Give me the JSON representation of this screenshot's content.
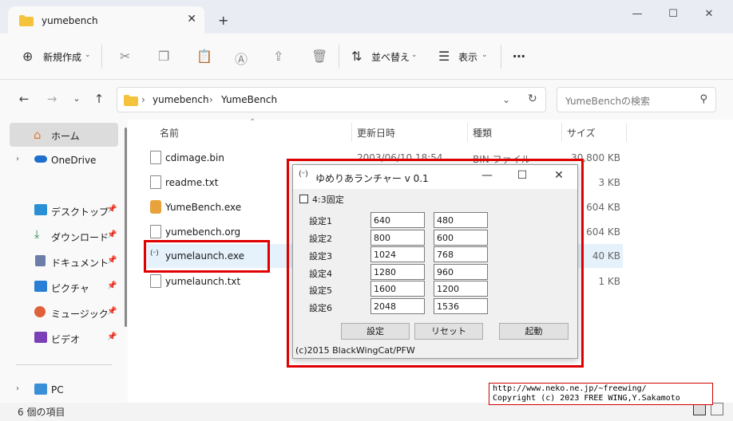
{
  "window": {
    "tab_title": "yumebench",
    "tab_close": "✕",
    "new_tab": "+",
    "minimize": "—",
    "maximize": "☐",
    "close": "✕"
  },
  "toolbar": {
    "new_label": "新規作成",
    "sort_label": "並べ替え",
    "view_label": "表示",
    "more": "⋯"
  },
  "address": {
    "crumbs": [
      "yumebench",
      "YumeBench"
    ],
    "search_placeholder": "YumeBenchの検索"
  },
  "sidebar": {
    "items": [
      {
        "label": "ホーム"
      },
      {
        "label": "OneDrive"
      },
      {
        "label": "デスクトップ"
      },
      {
        "label": "ダウンロード"
      },
      {
        "label": "ドキュメント"
      },
      {
        "label": "ピクチャ"
      },
      {
        "label": "ミュージック"
      },
      {
        "label": "ビデオ"
      },
      {
        "label": "PC"
      }
    ]
  },
  "columns": {
    "name": "名前",
    "date": "更新日時",
    "type": "種類",
    "size": "サイズ"
  },
  "files": [
    {
      "name": "cdimage.bin",
      "date": "2003/06/10 18:54",
      "type": "BIN ファイル",
      "size": "30,800 KB"
    },
    {
      "name": "readme.txt",
      "date": "",
      "type": "",
      "size": "3 KB"
    },
    {
      "name": "YumeBench.exe",
      "date": "",
      "type": "",
      "size": "604 KB"
    },
    {
      "name": "yumebench.org",
      "date": "",
      "type": "",
      "size": "604 KB"
    },
    {
      "name": "yumelaunch.exe",
      "date": "",
      "type": "",
      "size": "40 KB"
    },
    {
      "name": "yumelaunch.txt",
      "date": "",
      "type": "",
      "size": "1 KB"
    }
  ],
  "status": {
    "item_count": "6 個の項目"
  },
  "dialog": {
    "title": "ゆめりあランチャー v 0.1",
    "checkbox_label": "4:3固定",
    "settings": [
      {
        "label": "設定1",
        "w": "640",
        "h": "480"
      },
      {
        "label": "設定2",
        "w": "800",
        "h": "600"
      },
      {
        "label": "設定3",
        "w": "1024",
        "h": "768"
      },
      {
        "label": "設定4",
        "w": "1280",
        "h": "960"
      },
      {
        "label": "設定5",
        "w": "1600",
        "h": "1200"
      },
      {
        "label": "設定6",
        "w": "2048",
        "h": "1536"
      }
    ],
    "btn_set": "設定",
    "btn_reset": "リセット",
    "btn_launch": "起動",
    "footer": "(c)2015 BlackWingCat/PFW"
  },
  "copyright": {
    "line1": "http://www.neko.ne.jp/~freewing/",
    "line2": "Copyright (c) 2023 FREE WING,Y.Sakamoto"
  }
}
